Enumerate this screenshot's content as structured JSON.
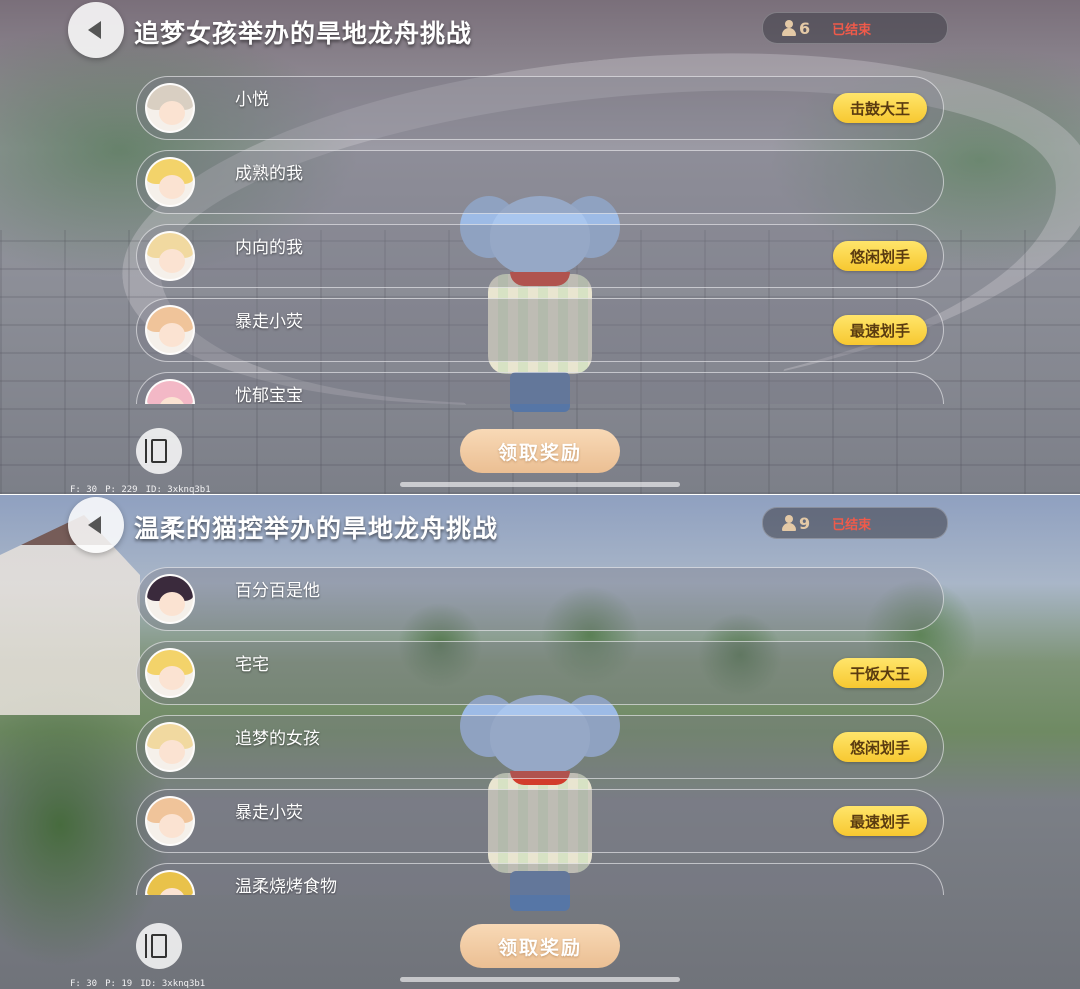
{
  "panels": [
    {
      "title": "追梦女孩举办的旱地龙舟挑战",
      "participant_count": "6",
      "status": "已结束",
      "players": [
        {
          "name": "小悦",
          "badge": "击鼓大王",
          "hair": "#d9cfc2"
        },
        {
          "name": "成熟的我",
          "badge": "",
          "hair": "#f3d36a"
        },
        {
          "name": "内向的我",
          "badge": "悠闲划手",
          "hair": "#f1d9a0"
        },
        {
          "name": "暴走小荧",
          "badge": "最速划手",
          "hair": "#f0c49a"
        },
        {
          "name": "忧郁宝宝",
          "badge": "",
          "hair": "#f3b8c6"
        }
      ],
      "claim_label": "领取奖励",
      "debug": {
        "f": "F: 30",
        "p": "P: 229",
        "id": "ID: 3xknq3b1"
      }
    },
    {
      "title": "温柔的猫控举办的旱地龙舟挑战",
      "participant_count": "9",
      "status": "已结束",
      "players": [
        {
          "name": "百分百是他",
          "badge": "",
          "hair": "#3a2a3c"
        },
        {
          "name": "宅宅",
          "badge": "干饭大王",
          "hair": "#f3d36a"
        },
        {
          "name": "追梦的女孩",
          "badge": "悠闲划手",
          "hair": "#f1d9a0"
        },
        {
          "name": "暴走小荧",
          "badge": "最速划手",
          "hair": "#f0c49a"
        },
        {
          "name": "温柔烧烤食物",
          "badge": "",
          "hair": "#e9c24a"
        }
      ],
      "claim_label": "领取奖励",
      "debug": {
        "f": "F: 30",
        "p": "P: 19",
        "id": "ID: 3xknq3b1"
      }
    }
  ],
  "colors": {
    "badge": "#f7c830",
    "claim": "#ebbf93",
    "status_ended": "#f05a4a"
  }
}
